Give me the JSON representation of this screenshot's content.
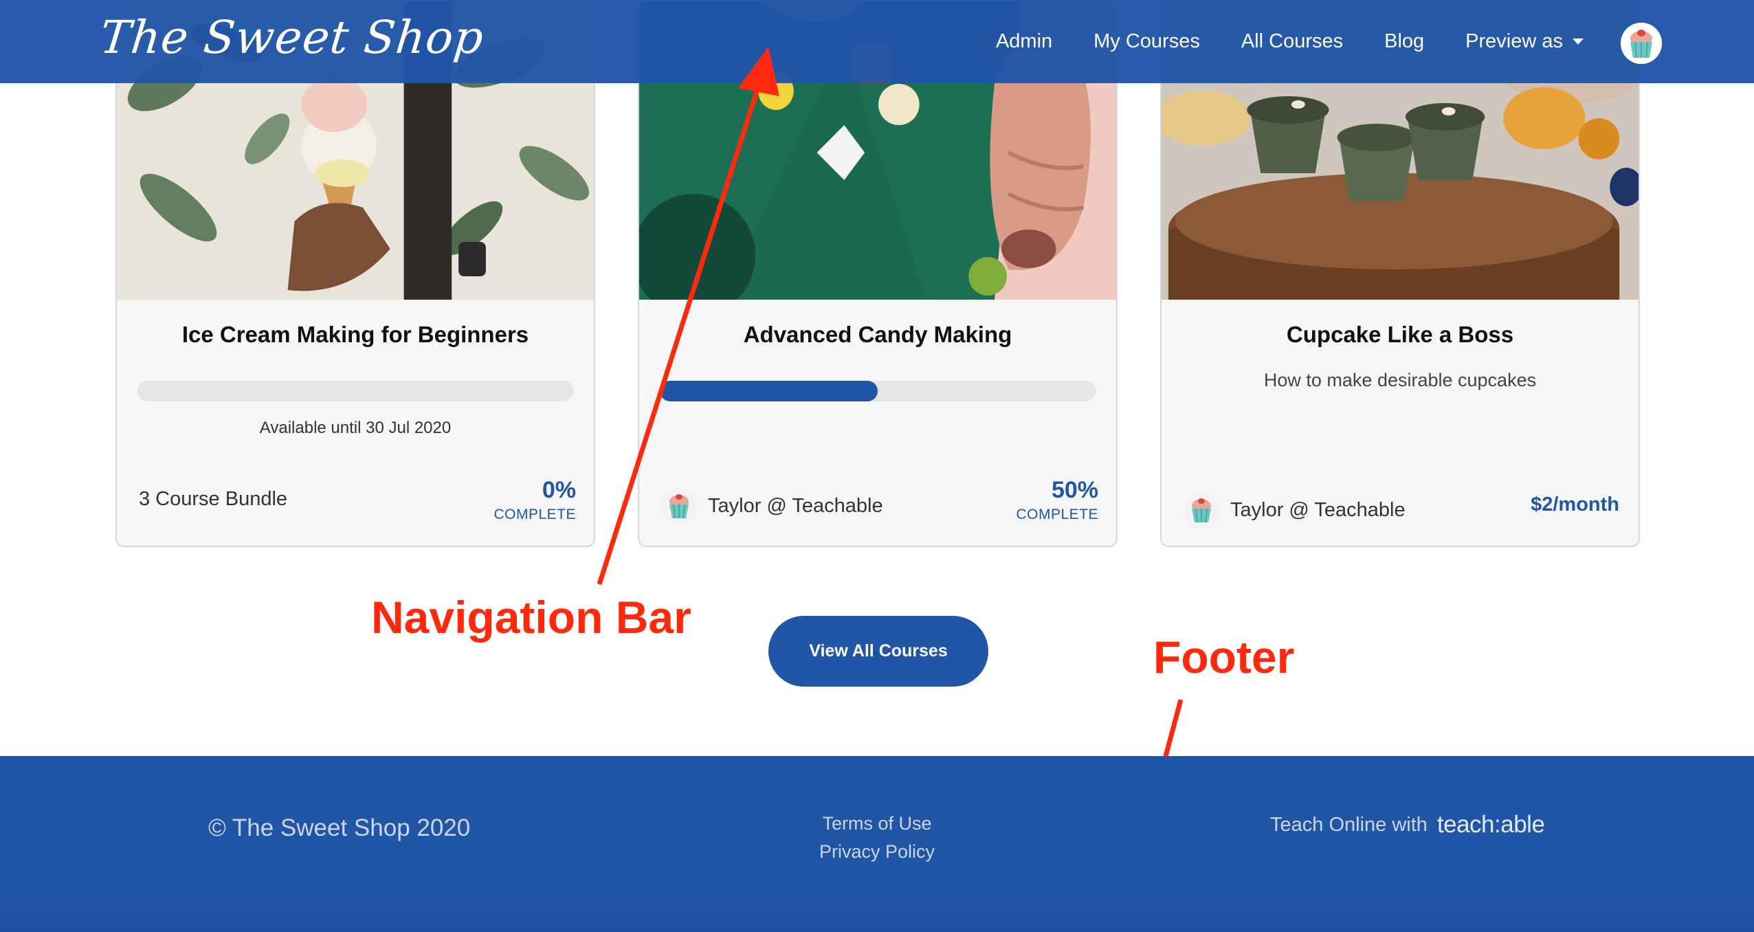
{
  "nav": {
    "brand": "The Sweet Shop",
    "links": [
      "Admin",
      "My Courses",
      "All Courses",
      "Blog"
    ],
    "preview_label": "Preview as"
  },
  "courses": [
    {
      "title": "Ice Cream Making for Beginners",
      "progress_fraction": 0,
      "note": "Available until 30 Jul 2020",
      "footer_left": "3 Course Bundle",
      "percent": "0%",
      "percent_label": "COMPLETE",
      "image": "ice-cream-cone-photo"
    },
    {
      "title": "Advanced Candy Making",
      "progress_fraction": 0.5,
      "author": "Taylor @ Teachable",
      "percent": "50%",
      "percent_label": "COMPLETE",
      "image": "candy-chocolates-photo"
    },
    {
      "title": "Cupcake Like a Boss",
      "subtitle": "How to make desirable cupcakes",
      "author": "Taylor @ Teachable",
      "price": "$2/month",
      "image": "cupcakes-on-wood-board-photo"
    }
  ],
  "cta": {
    "label": "View All Courses"
  },
  "annotations": {
    "navigation_bar": "Navigation Bar",
    "footer": "Footer",
    "color": "#ff2a0d"
  },
  "footer": {
    "copyright": "© The Sweet Shop 2020",
    "links": [
      "Terms of Use",
      "Privacy Policy"
    ],
    "teach_text": "Teach Online with",
    "teach_logo": "teach:able"
  },
  "colors": {
    "brand_blue": "#2155a6",
    "card_bg": "#f6f6f6",
    "track_gray": "#e5e5e5"
  }
}
